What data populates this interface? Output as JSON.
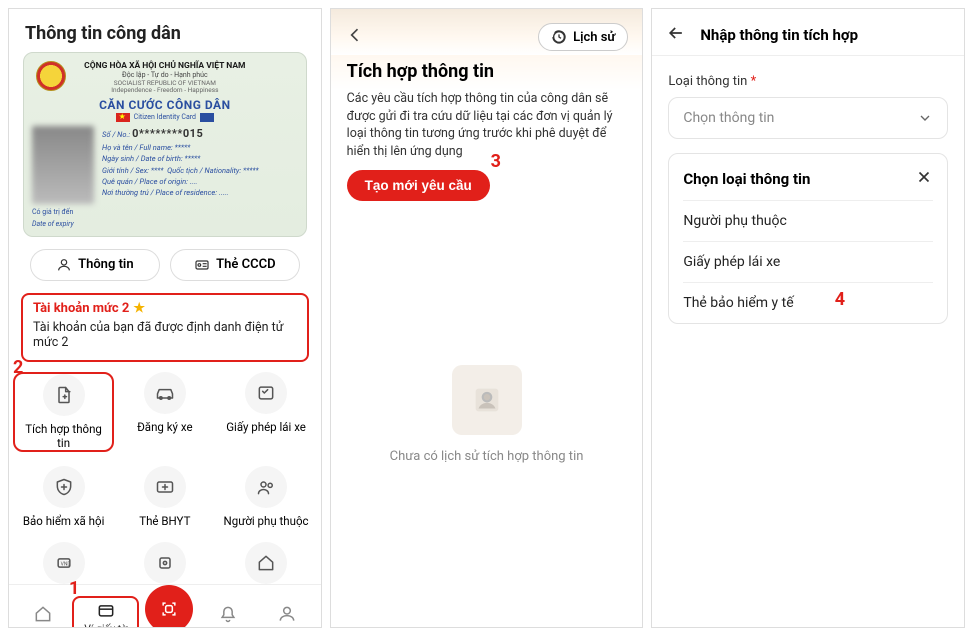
{
  "screen1": {
    "header": "Thông tin công dân",
    "card": {
      "country": "CỘNG HÒA XÃ HỘI CHỦ NGHĨA VIỆT NAM",
      "motto": "Độc lập - Tự do - Hạnh phúc",
      "sub_en": "SOCIALIST REPUBLIC OF VIETNAM",
      "sub_en2": "Independence - Freedom - Happiness",
      "title": "CĂN CƯỚC CÔNG DÂN",
      "sub2": "Citizen Identity Card",
      "rows": {
        "num_lbl": "Số / No.:",
        "num_val": "0********015",
        "name_lbl": "Họ và tên / Full name: *****",
        "dob_lbl": "Ngày sinh / Date of birth: *****",
        "sex_lbl": "Giới tính / Sex: ****",
        "nat_lbl": "Quốc tịch / Nationality: *****",
        "origin_lbl": "Quê quán / Place of origin: ....",
        "res_lbl": "Nơi thường trú / Place of residence: ....."
      },
      "expiry_lbl": "Có giá trị đến",
      "expiry_en": "Date of expiry"
    },
    "pill_info": "Thông tin",
    "pill_cccd": "Thẻ CCCD",
    "account": {
      "title": "Tài khoản mức 2",
      "desc": "Tài khoản của bạn đã được định danh điện tử mức 2"
    },
    "grid": {
      "g1": "Tích hợp thông tin",
      "g2": "Đăng ký xe",
      "g3": "Giấy phép lái xe",
      "g4": "Bảo hiểm xã hội",
      "g5": "Thẻ BHYT",
      "g6": "Người phụ thuộc"
    },
    "nav": {
      "n1": "Trang chủ",
      "n2": "Ví giấy tờ",
      "n3": "Thông báo",
      "n4": "Cá nhân"
    },
    "anno1": "1",
    "anno2": "2"
  },
  "screen2": {
    "history": "Lịch sử",
    "title": "Tích hợp thông tin",
    "desc": "Các yêu cầu tích hợp thông tin của công dân sẽ được gửi đi tra cứu dữ liệu tại các đơn vị quản lý loại thông tin tương ứng trước khi phê duyệt để hiển thị lên ứng dụng",
    "cta": "Tạo mới yêu cầu",
    "empty": "Chưa có lịch sử tích hợp thông tin",
    "anno": "3"
  },
  "screen3": {
    "title": "Nhập thông tin tích hợp",
    "label": "Loại thông tin",
    "placeholder": "Chọn thông tin",
    "sheet_title": "Chọn loại thông tin",
    "opt1": "Người phụ thuộc",
    "opt2": "Giấy phép lái xe",
    "opt3": "Thẻ bảo hiểm y tế",
    "anno": "4"
  }
}
